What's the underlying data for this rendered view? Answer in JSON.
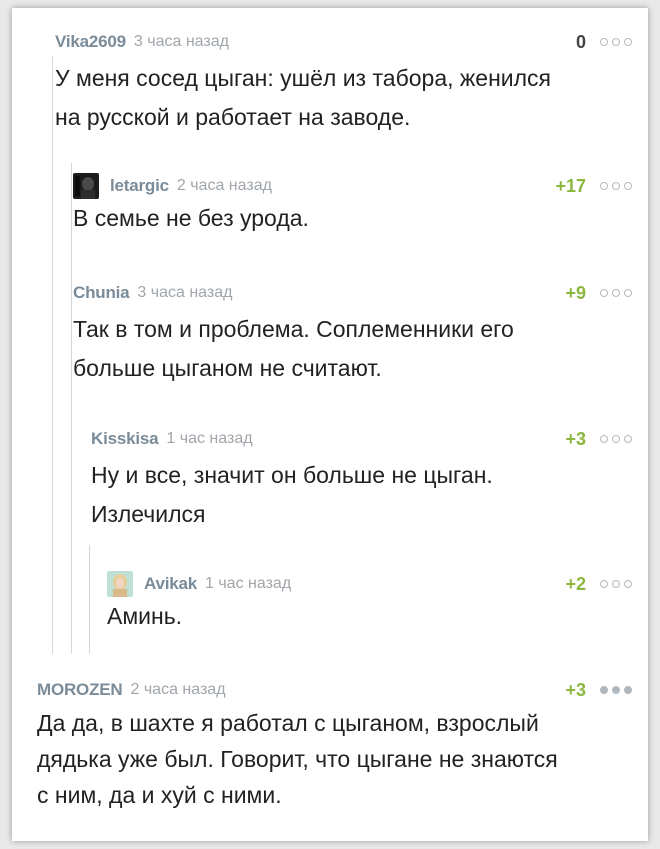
{
  "comments": [
    {
      "author": "Vika2609",
      "time": "3 часа назад",
      "rating": "0",
      "text": "У меня сосед цыган: ушёл из табора, женился\nна русской и работает на заводе.",
      "avatar": "none"
    },
    {
      "author": "letargic",
      "time": "2 часа назад",
      "rating": "+17",
      "text": "В семье не без урода.",
      "avatar": "dark-portrait"
    },
    {
      "author": "Chunia",
      "time": "3 часа назад",
      "rating": "+9",
      "text": "Так в том и проблема. Соплеменники его\nбольше цыганом не считают.",
      "avatar": "none"
    },
    {
      "author": "Kisskisa",
      "time": "1 час назад",
      "rating": "+3",
      "text": "Ну и все, значит он больше не цыган.\nИзлечился",
      "avatar": "none"
    },
    {
      "author": "Avikak",
      "time": "1 час назад",
      "rating": "+2",
      "text": "Аминь.",
      "avatar": "blonde-portrait"
    },
    {
      "author": "MOROZEN",
      "time": "2 часа назад",
      "rating": "+3",
      "text": "Да да, в шахте я работал с цыганом, взрослый\nдядька уже был. Говорит, что цыгане не знаются\nс ним, да и хуй с ними.",
      "avatar": "none"
    }
  ],
  "icons": {
    "menu": "more-dots-icon"
  },
  "colors": {
    "positive": "#8bb73f",
    "neutral": "#444444",
    "author": "#7a8c99",
    "time": "#a0a6ab"
  }
}
